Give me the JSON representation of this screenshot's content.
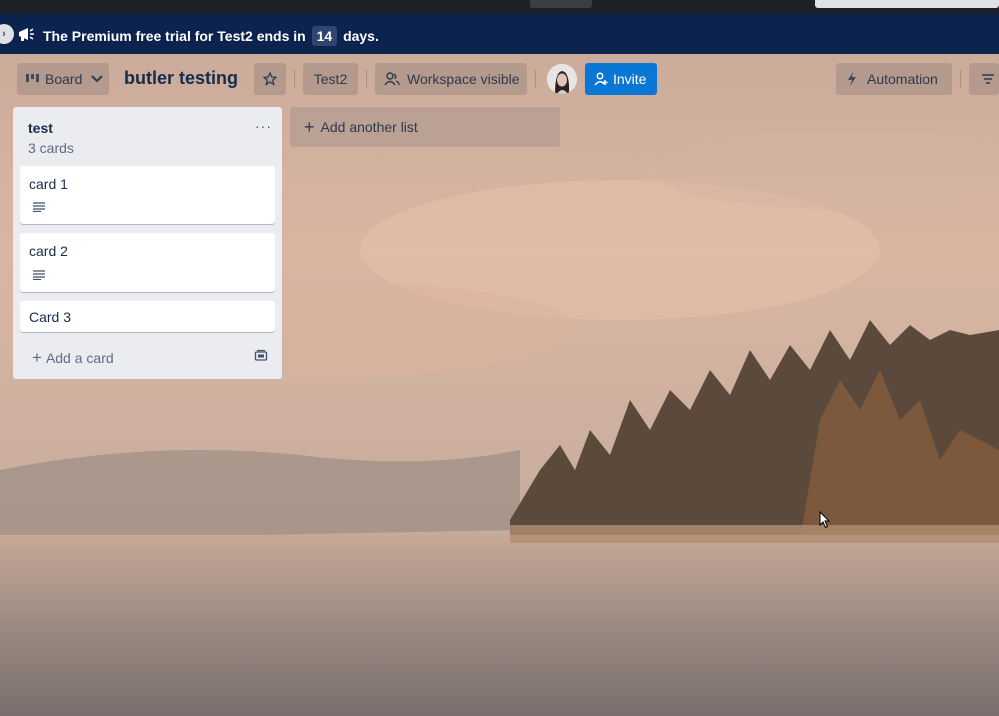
{
  "banner": {
    "text_before": "The Premium free trial for Test2 ends in",
    "days": "14",
    "text_after": "days."
  },
  "header": {
    "view_label": "Board",
    "board_title": "butler testing",
    "workspace_label": "Test2",
    "visibility_label": "Workspace visible",
    "invite_label": "Invite",
    "automation_label": "Automation"
  },
  "list": {
    "title": "test",
    "count": "3 cards",
    "menu": "···",
    "cards": [
      {
        "title": "card 1",
        "has_description": true
      },
      {
        "title": "card 2",
        "has_description": true
      },
      {
        "title": "Card 3",
        "has_description": false
      }
    ],
    "add_card_label": "Add a card"
  },
  "add_list_label": "Add another list",
  "colors": {
    "banner": "#0c2350",
    "invite": "#0b77d4",
    "list_bg": "#ebecf0"
  }
}
